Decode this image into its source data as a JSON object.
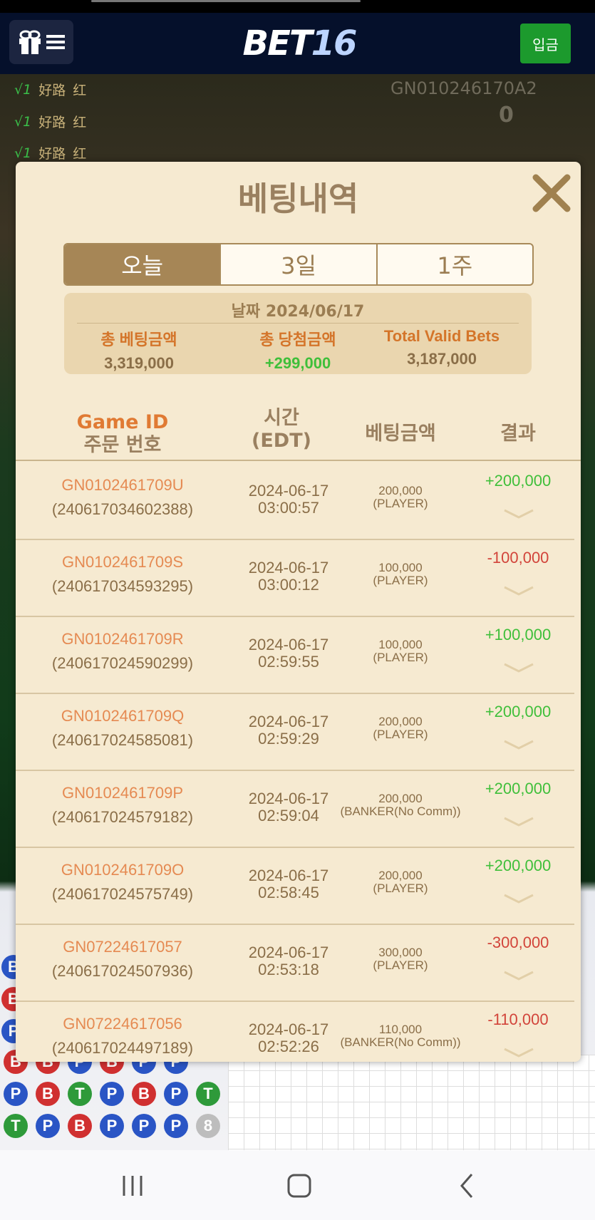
{
  "header": {
    "logo_bet": "BET",
    "logo_num": "16",
    "deposit_label": "입금"
  },
  "background": {
    "game_id": "GN010246170A2",
    "coin_count": "0",
    "rows": [
      {
        "check": "√1",
        "label": "好路",
        "color": "红"
      },
      {
        "check": "√1",
        "label": "好路",
        "color": "红"
      },
      {
        "check": "√1",
        "label": "好路",
        "color": "红"
      }
    ]
  },
  "modal": {
    "title": "베팅내역",
    "tabs": [
      "오늘",
      "3일",
      "1주"
    ],
    "active_tab": 0,
    "summary": {
      "date_label": "날짜",
      "date": "2024/06/17",
      "total_bet_label": "총 베팅금액",
      "total_bet": "3,319,000",
      "total_win_label": "총 당첨금액",
      "total_win": "+299,000",
      "valid_label": "Total Valid Bets",
      "valid": "3,187,000"
    },
    "headers": {
      "game_id": "Game ID",
      "order_no": "주문 번호",
      "time": "시간",
      "tz": "(EDT)",
      "amount": "베팅금액",
      "result": "결과"
    },
    "rows": [
      {
        "game_id": "GN0102461709U",
        "order": "(240617034602388)",
        "date": "2024-06-17",
        "time": "03:00:57",
        "amount": "200,000",
        "bet": "(PLAYER)",
        "result": "+200,000",
        "win": true
      },
      {
        "game_id": "GN0102461709S",
        "order": "(240617034593295)",
        "date": "2024-06-17",
        "time": "03:00:12",
        "amount": "100,000",
        "bet": "(PLAYER)",
        "result": "-100,000",
        "win": false
      },
      {
        "game_id": "GN0102461709R",
        "order": "(240617024590299)",
        "date": "2024-06-17",
        "time": "02:59:55",
        "amount": "100,000",
        "bet": "(PLAYER)",
        "result": "+100,000",
        "win": true
      },
      {
        "game_id": "GN0102461709Q",
        "order": "(240617024585081)",
        "date": "2024-06-17",
        "time": "02:59:29",
        "amount": "200,000",
        "bet": "(PLAYER)",
        "result": "+200,000",
        "win": true
      },
      {
        "game_id": "GN0102461709P",
        "order": "(240617024579182)",
        "date": "2024-06-17",
        "time": "02:59:04",
        "amount": "200,000",
        "bet": "(BANKER(No Comm))",
        "result": "+200,000",
        "win": true
      },
      {
        "game_id": "GN0102461709O",
        "order": "(240617024575749)",
        "date": "2024-06-17",
        "time": "02:58:45",
        "amount": "200,000",
        "bet": "(PLAYER)",
        "result": "+200,000",
        "win": true
      },
      {
        "game_id": "GN07224617057",
        "order": "(240617024507936)",
        "date": "2024-06-17",
        "time": "02:53:18",
        "amount": "300,000",
        "bet": "(PLAYER)",
        "result": "-300,000",
        "win": false
      },
      {
        "game_id": "GN07224617056",
        "order": "(240617024497189)",
        "date": "2024-06-17",
        "time": "02:52:26",
        "amount": "110,000",
        "bet": "(BANKER(No Comm))",
        "result": "-110,000",
        "win": false
      }
    ]
  },
  "colors": {
    "accent": "#a68656",
    "win": "#3fbf3a",
    "loss": "#d2443a",
    "deposit": "#1c9a2d"
  }
}
